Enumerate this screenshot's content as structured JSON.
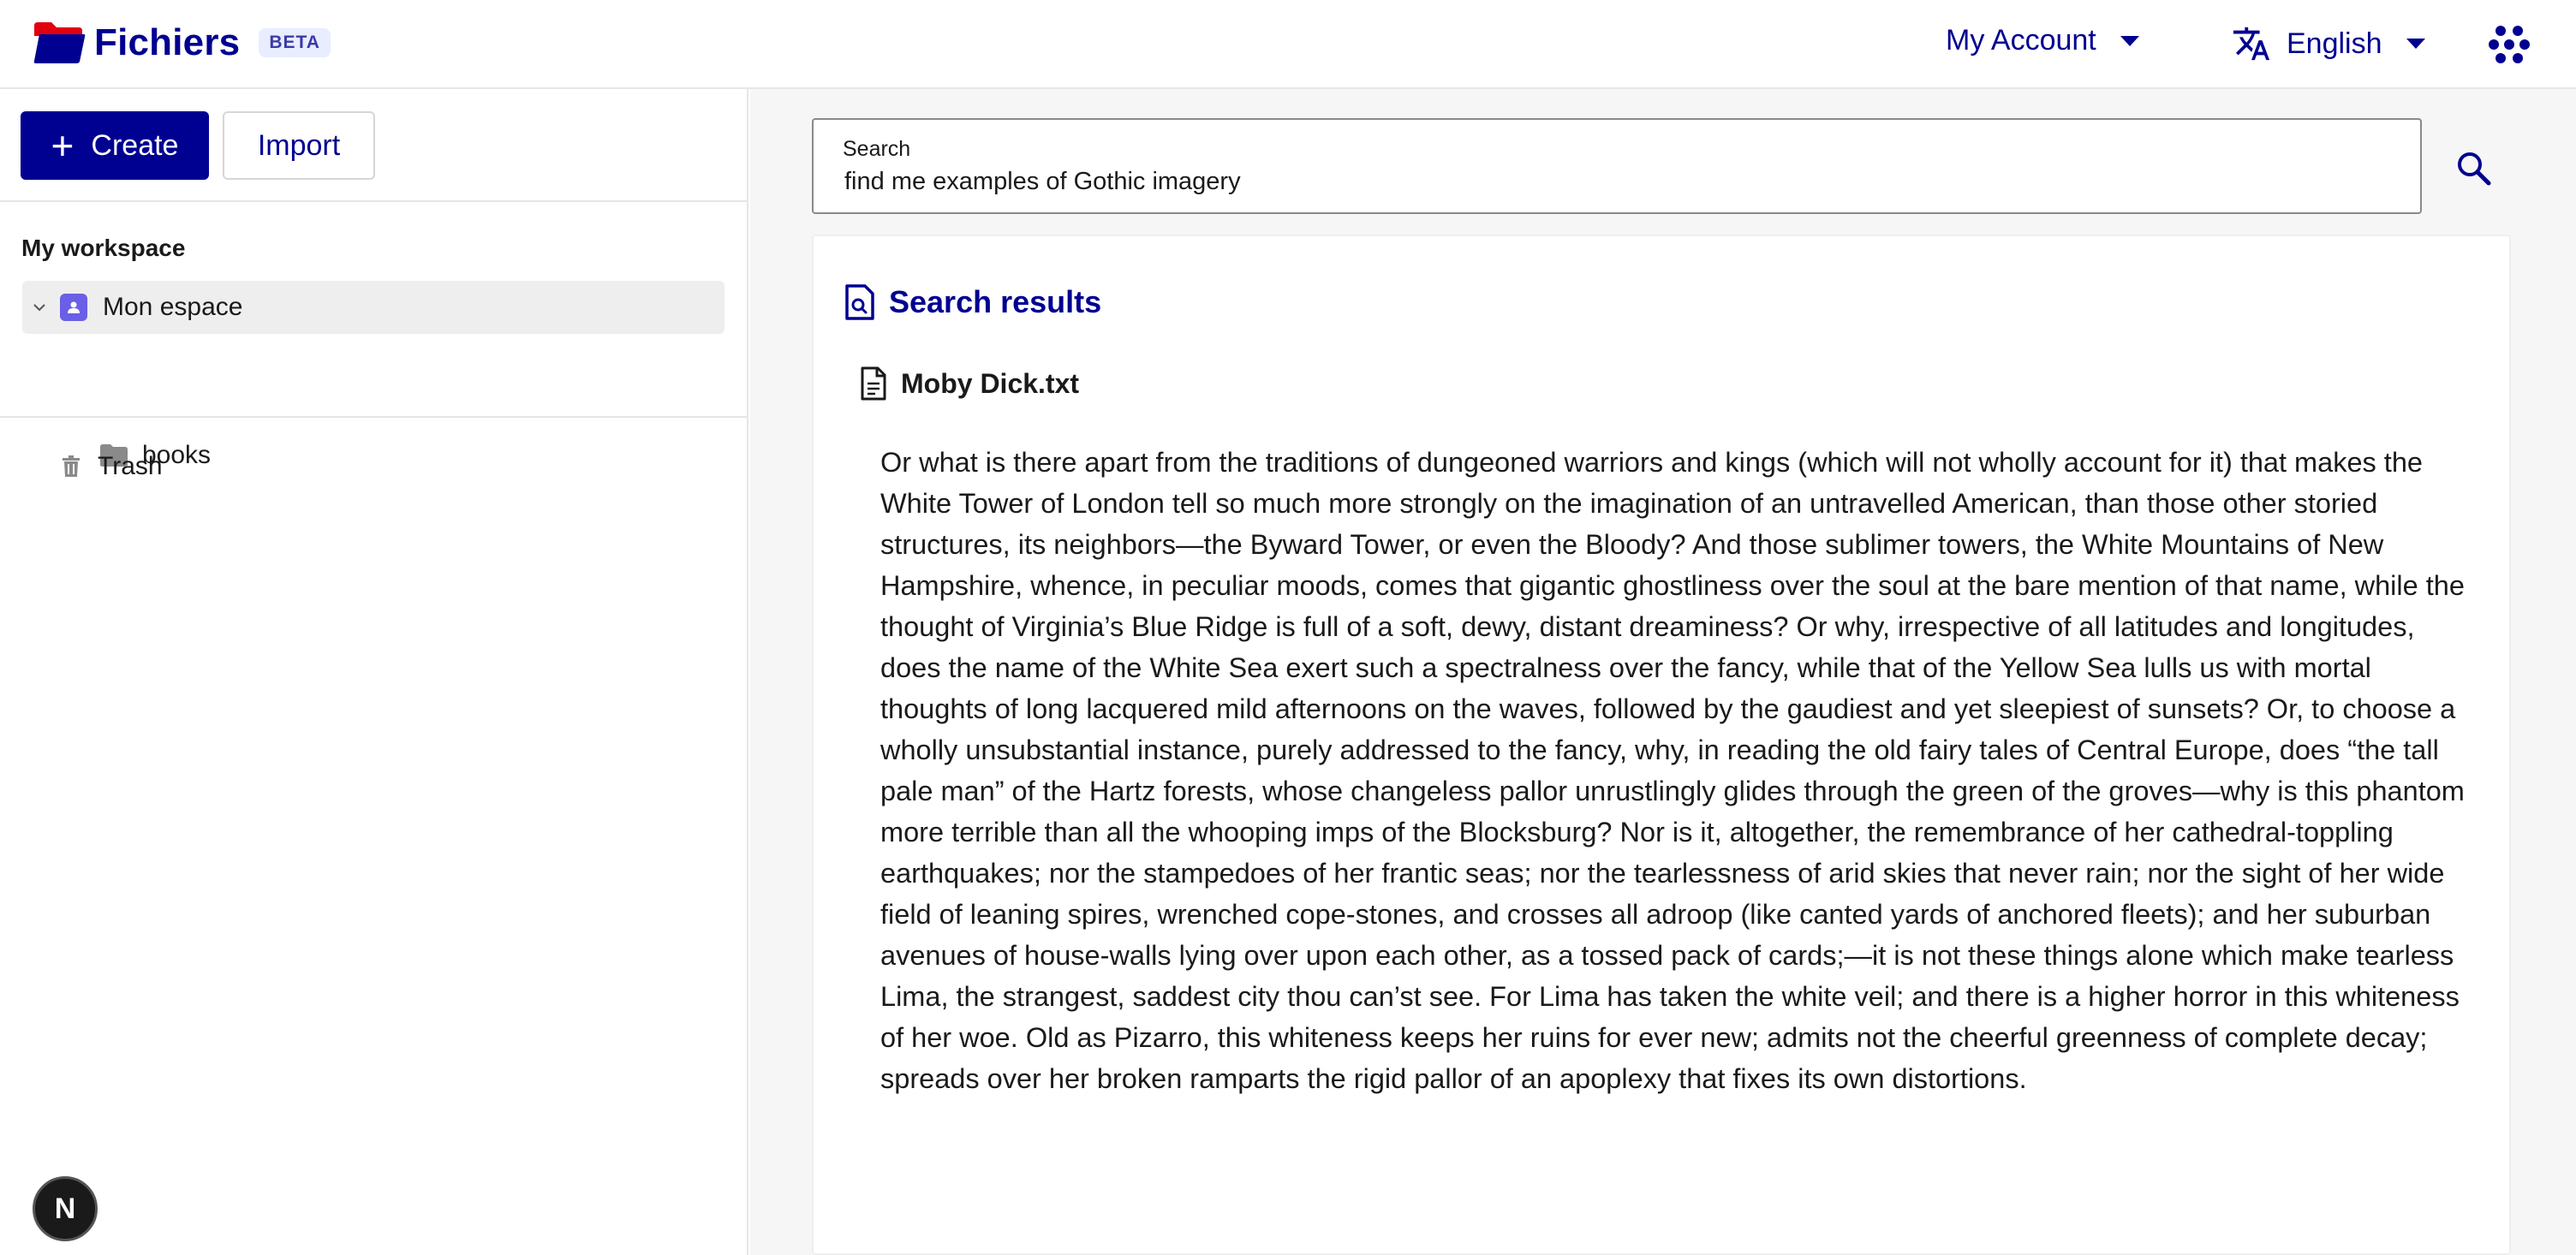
{
  "header": {
    "app_title": "Fichiers",
    "badge": "BETA",
    "account_label": "My Account",
    "language_label": "English",
    "brand_color": "#000091"
  },
  "sidebar": {
    "create_label": "Create",
    "import_label": "Import",
    "workspace_title": "My workspace",
    "tree": [
      {
        "label": "Mon espace",
        "icon": "user-space-icon",
        "expanded": true
      },
      {
        "label": "books",
        "icon": "folder-icon"
      }
    ],
    "trash_label": "Trash",
    "dev_badge": "N"
  },
  "main": {
    "search": {
      "label": "Search",
      "value": "find me examples of Gothic imagery"
    },
    "results_title": "Search results",
    "results": [
      {
        "file": "Moby Dick.txt",
        "excerpt": "Or what is there apart from the traditions of dungeoned warriors and kings (which will not wholly account for it) that makes the White Tower of London tell so much more strongly on the imagination of an untravelled American, than those other storied structures, its neighbors—the Byward Tower, or even the Bloody? And those sublimer towers, the White Mountains of New Hampshire, whence, in peculiar moods, comes that gigantic ghostliness over the soul at the bare mention of that name, while the thought of Virginia’s Blue Ridge is full of a soft, dewy, distant dreaminess? Or why, irrespective of all latitudes and longitudes, does the name of the White Sea exert such a spectralness over the fancy, while that of the Yellow Sea lulls us with mortal thoughts of long lacquered mild afternoons on the waves, followed by the gaudiest and yet sleepiest of sunsets? Or, to choose a wholly unsubstantial instance, purely addressed to the fancy, why, in reading the old fairy tales of Central Europe, does “the tall pale man” of the Hartz forests, whose changeless pallor unrustlingly glides through the green of the groves—why is this phantom more terrible than all the whooping imps of the Blocksburg? Nor is it, altogether, the remembrance of her cathedral-toppling earthquakes; nor the stampedoes of her frantic seas; nor the tearlessness of arid skies that never rain; nor the sight of her wide field of leaning spires, wrenched cope-stones, and crosses all adroop (like canted yards of anchored fleets); and her suburban avenues of house-walls lying over upon each other, as a tossed pack of cards;—it is not these things alone which make tearless Lima, the strangest, saddest city thou can’st see. For Lima has taken the white veil; and there is a higher horror in this whiteness of her woe. Old as Pizarro, this whiteness keeps her ruins for ever new; admits not the cheerful greenness of complete decay; spreads over her broken ramparts the rigid pallor of an apoplexy that fixes its own distortions."
      }
    ]
  }
}
